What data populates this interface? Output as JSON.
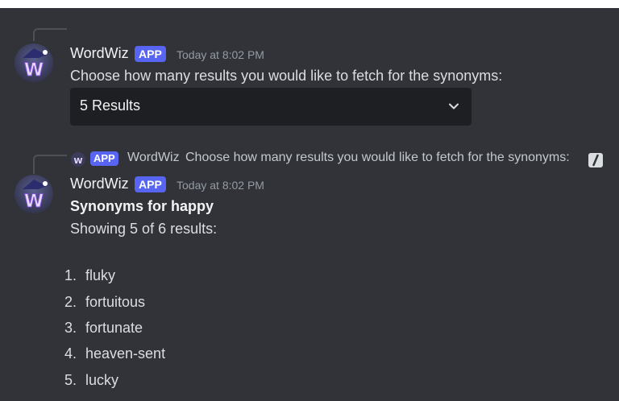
{
  "messages": [
    {
      "author": "WordWiz",
      "badge": "APP",
      "timestamp": "Today at 8:02 PM",
      "content": "Choose how many results you would like to fetch for the synonyms:",
      "select": {
        "selected": "5 Results"
      }
    },
    {
      "reply_preview": {
        "badge": "APP",
        "author": "WordWiz",
        "text": "Choose how many results you would like to fetch for the synonyms:"
      },
      "author": "WordWiz",
      "badge": "APP",
      "timestamp": "Today at 8:02 PM",
      "title": "Synonyms for happy",
      "subtitle": "Showing 5 of 6 results:",
      "results": [
        {
          "num": "1.",
          "word": "fluky"
        },
        {
          "num": "2.",
          "word": "fortuitous"
        },
        {
          "num": "3.",
          "word": "fortunate"
        },
        {
          "num": "4.",
          "word": "heaven-sent"
        },
        {
          "num": "5.",
          "word": "lucky"
        }
      ]
    }
  ],
  "icons": {
    "avatar": "wizard-w-icon",
    "select_chevron": "chevron-down-icon",
    "slash_command": "slash-command-icon"
  },
  "colors": {
    "background": "#313338",
    "app_badge": "#5865f2",
    "select_bg": "#1e1f22",
    "timestamp": "#949ba4"
  }
}
